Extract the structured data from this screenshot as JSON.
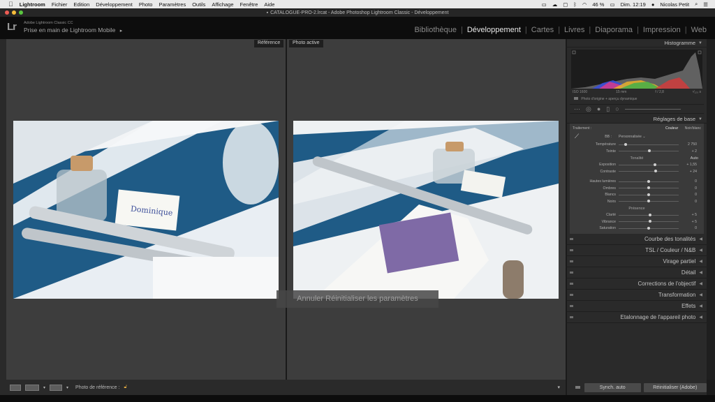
{
  "menubar": {
    "apple": "",
    "app_name": "Lightroom",
    "items": [
      "Fichier",
      "Edition",
      "Développement",
      "Photo",
      "Paramètres",
      "Outils",
      "Affichage",
      "Fenêtre",
      "Aide"
    ],
    "battery": "46 %",
    "clock": "Dim. 12:19",
    "user": "Nicolas Petit"
  },
  "window": {
    "title": "CATALOGUE-PRO-2.lrcat - Adobe Photoshop Lightroom Classic - Développement"
  },
  "identity": {
    "logo": "Lr",
    "product": "Adobe Lightroom Classic CC",
    "status": "Prise en main de Lightroom Mobile",
    "status_arrow": "▸"
  },
  "modules": [
    "Bibliothèque",
    "Développement",
    "Cartes",
    "Livres",
    "Diaporama",
    "Impression",
    "Web"
  ],
  "active_module": "Développement",
  "compare": {
    "reference_label": "Référence",
    "active_label": "Photo active",
    "toast": "Annuler Réinitialiser les paramètres"
  },
  "histogram": {
    "title": "Histogramme",
    "iso": "ISO 1600",
    "focal": "15 mm",
    "aperture": "f / 2,8",
    "shutter": "¹⁄₁₂₅ s",
    "note": "Photo d'origine + aperçu dynamique"
  },
  "basic": {
    "title": "Réglages de base",
    "treatment_label": "Traitement :",
    "color": "Couleur",
    "bw": "Noir/blanc",
    "wb_label": "BB :",
    "wb_value": "Personnalisée",
    "sliders_wb": [
      {
        "label": "Température",
        "value": "2 750",
        "pos": 0.12
      },
      {
        "label": "Teinte",
        "value": "+ 2",
        "pos": 0.51
      }
    ],
    "tone_label": "Tonalité",
    "auto": "Auto",
    "sliders_tone": [
      {
        "label": "Exposition",
        "value": "+ 1,55",
        "pos": 0.6
      },
      {
        "label": "Contraste",
        "value": "+ 24",
        "pos": 0.62
      }
    ],
    "sliders_tone2": [
      {
        "label": "Hautes lumières",
        "value": "0",
        "pos": 0.5
      },
      {
        "label": "Ombres",
        "value": "0",
        "pos": 0.5
      },
      {
        "label": "Blancs",
        "value": "0",
        "pos": 0.5
      },
      {
        "label": "Noirs",
        "value": "0",
        "pos": 0.5
      }
    ],
    "presence_label": "Présence",
    "sliders_presence": [
      {
        "label": "Clarté",
        "value": "+ 5",
        "pos": 0.52
      },
      {
        "label": "Vibrance",
        "value": "+ 5",
        "pos": 0.52
      },
      {
        "label": "Saturation",
        "value": "0",
        "pos": 0.5
      }
    ]
  },
  "panels": [
    "Courbe des tonalités",
    "TSL  /  Couleur  /  N&B",
    "Virage partiel",
    "Détail",
    "Corrections de l'objectif",
    "Transformation",
    "Effets",
    "Etalonnage de l'appareil photo"
  ],
  "bottom": {
    "ref_label": "Photo de référence :",
    "sync": "Synch. auto",
    "reset": "Réinitialiser (Adobe)"
  },
  "colors": {
    "accent": "#e8e8e8",
    "panel": "#2a2a2a",
    "workspace": "#3d3d3d"
  }
}
